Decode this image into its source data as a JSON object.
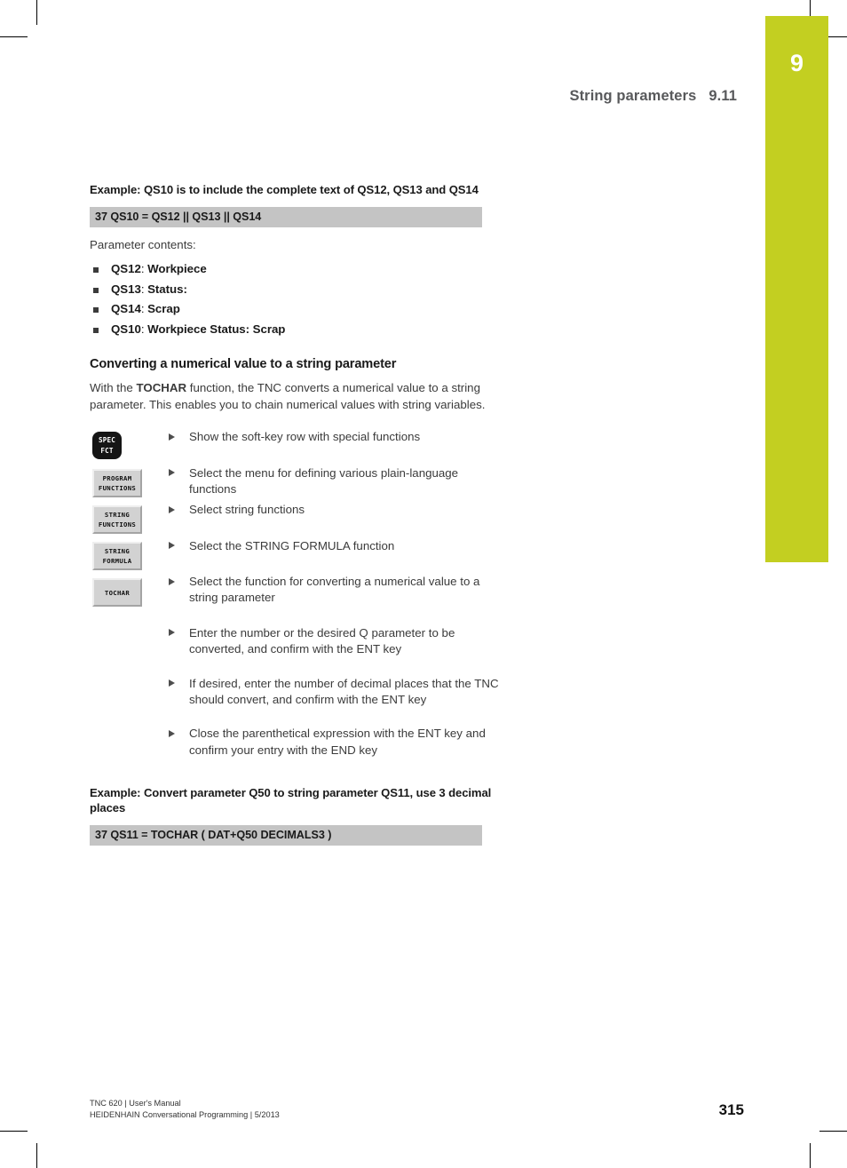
{
  "page": {
    "chapter_number": "9",
    "chapter_tab_color": "#c3cf21",
    "page_number": "315"
  },
  "running_head": {
    "title": "String parameters",
    "section": "9.11"
  },
  "example1": {
    "title": "Example: QS10 is to include the complete text of QS12, QS13 and QS14",
    "code": "37 QS10 = QS12 || QS13 || QS14",
    "intro": "Parameter contents:",
    "items": [
      {
        "param": "QS12",
        "sep": ": ",
        "value": "Workpiece"
      },
      {
        "param": "QS13",
        "sep": ": ",
        "value": "Status:"
      },
      {
        "param": "QS14",
        "sep": ": ",
        "value": "Scrap"
      },
      {
        "param": "QS10",
        "sep": ": ",
        "value": "Workpiece Status: Scrap"
      }
    ]
  },
  "section": {
    "heading": "Converting a numerical value to a string parameter",
    "paragraph_part1": "With the ",
    "paragraph_bold": "TOCHAR",
    "paragraph_part2": " function, the TNC converts a numerical value to a string parameter. This enables you to chain numerical values with string variables."
  },
  "softkeys": [
    {
      "name": "spec-fct",
      "line1": "SPEC",
      "line2": "FCT",
      "style": "hard"
    },
    {
      "name": "program-functions",
      "line1": "PROGRAM",
      "line2": "FUNCTIONS",
      "style": "gray"
    },
    {
      "name": "string-functions",
      "line1": "STRING",
      "line2": "FUNCTIONS",
      "style": "gray"
    },
    {
      "name": "string-formula",
      "line1": "STRING",
      "line2": "FORMULA",
      "style": "gray"
    },
    {
      "name": "tochar",
      "line1": "TOCHAR",
      "line2": "",
      "style": "gray"
    }
  ],
  "steps": [
    {
      "text": "Show the soft-key row with special functions"
    },
    {
      "text": "Select the menu for defining various plain-language functions"
    },
    {
      "text": "Select string functions"
    },
    {
      "text": "Select the STRING FORMULA function"
    },
    {
      "text": "Select the function for converting a numerical value to a string parameter"
    },
    {
      "text": "Enter the number or the desired Q parameter to be converted, and confirm with the ENT key"
    },
    {
      "text": "If desired, enter the number of decimal places that the TNC should convert, and confirm with the ENT key"
    },
    {
      "text": "Close the parenthetical expression with the ENT key and confirm your entry with the END key"
    }
  ],
  "example2": {
    "title": "Example: Convert parameter Q50 to string parameter QS11, use 3 decimal places",
    "code": "37 QS11 = TOCHAR ( DAT+Q50 DECIMALS3 )"
  },
  "footer": {
    "line1": "TNC 620 | User's Manual",
    "line2": "HEIDENHAIN Conversational Programming | 5/2013"
  }
}
